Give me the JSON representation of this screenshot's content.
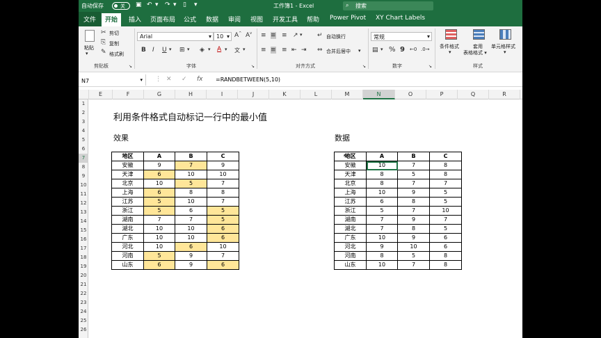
{
  "titlebar": {
    "autosave_label": "自动保存",
    "autosave_state": "关",
    "title": "工作簿1 - Excel",
    "search_placeholder": "搜索"
  },
  "tabs": [
    "文件",
    "开始",
    "插入",
    "页面布局",
    "公式",
    "数据",
    "审阅",
    "视图",
    "开发工具",
    "帮助",
    "Power Pivot",
    "XY Chart Labels"
  ],
  "ribbon": {
    "paste": "粘贴",
    "cut": "剪切",
    "copy": "复制",
    "format_painter": "格式刷",
    "clipboard_group": "剪贴板",
    "font_name": "Arial",
    "font_size": "10",
    "font_group": "字体",
    "wrap_text": "自动换行",
    "merge_center": "合并后居中",
    "alignment_group": "对齐方式",
    "number_format": "常规",
    "number_group": "数字",
    "conditional_format": "条件格式",
    "format_as_table": "套用\n表格格式",
    "cell_styles": "单元格样式",
    "styles_group": "样式",
    "bold": "B",
    "italic": "I",
    "underline": "U",
    "percent": "%",
    "comma": "9"
  },
  "formula_bar": {
    "name_box": "N7",
    "formula": "=RANDBETWEEN(5,10)",
    "fx": "fx"
  },
  "grid": {
    "columns": [
      "E",
      "F",
      "G",
      "H",
      "I",
      "J",
      "K",
      "L",
      "M",
      "N",
      "O",
      "P",
      "Q",
      "R"
    ],
    "selected_column": "N",
    "rows": [
      "1",
      "2",
      "3",
      "4",
      "5",
      "6",
      "7",
      "8",
      "9",
      "10",
      "11",
      "12",
      "13",
      "14",
      "15",
      "16",
      "17",
      "18",
      "19",
      "20",
      "21",
      "22",
      "23",
      "24",
      "25",
      "26"
    ],
    "selected_row": "7"
  },
  "sheet": {
    "title": "利用条件格式自动标记一行中的最小值",
    "left_heading": "效果",
    "right_heading": "数据",
    "headers": [
      "地区",
      "A",
      "B",
      "C"
    ],
    "left_rows": [
      {
        "region": "安徽",
        "a": "9",
        "b": "7",
        "c": "9",
        "min": "b"
      },
      {
        "region": "天津",
        "a": "6",
        "b": "10",
        "c": "10",
        "min": "a"
      },
      {
        "region": "北京",
        "a": "10",
        "b": "5",
        "c": "7",
        "min": "b"
      },
      {
        "region": "上海",
        "a": "6",
        "b": "8",
        "c": "8",
        "min": "a"
      },
      {
        "region": "江苏",
        "a": "5",
        "b": "10",
        "c": "7",
        "min": "a"
      },
      {
        "region": "浙江",
        "a": "5",
        "b": "6",
        "c": "5",
        "min": "ac"
      },
      {
        "region": "湖南",
        "a": "7",
        "b": "7",
        "c": "5",
        "min": "c"
      },
      {
        "region": "湖北",
        "a": "10",
        "b": "10",
        "c": "6",
        "min": "c"
      },
      {
        "region": "广东",
        "a": "10",
        "b": "10",
        "c": "6",
        "min": "c"
      },
      {
        "region": "河北",
        "a": "10",
        "b": "6",
        "c": "10",
        "min": "b"
      },
      {
        "region": "河南",
        "a": "5",
        "b": "9",
        "c": "7",
        "min": "a"
      },
      {
        "region": "山东",
        "a": "6",
        "b": "9",
        "c": "6",
        "min": "ac"
      }
    ],
    "right_rows": [
      {
        "region": "安徽",
        "a": "10",
        "b": "7",
        "c": "8"
      },
      {
        "region": "天津",
        "a": "8",
        "b": "5",
        "c": "8"
      },
      {
        "region": "北京",
        "a": "8",
        "b": "7",
        "c": "7"
      },
      {
        "region": "上海",
        "a": "10",
        "b": "9",
        "c": "5"
      },
      {
        "region": "江苏",
        "a": "6",
        "b": "8",
        "c": "5"
      },
      {
        "region": "浙江",
        "a": "5",
        "b": "7",
        "c": "10"
      },
      {
        "region": "湖南",
        "a": "7",
        "b": "9",
        "c": "7"
      },
      {
        "region": "湖北",
        "a": "7",
        "b": "8",
        "c": "5"
      },
      {
        "region": "广东",
        "a": "10",
        "b": "9",
        "c": "6"
      },
      {
        "region": "河北",
        "a": "9",
        "b": "10",
        "c": "6"
      },
      {
        "region": "河南",
        "a": "8",
        "b": "5",
        "c": "8"
      },
      {
        "region": "山东",
        "a": "10",
        "b": "7",
        "c": "8"
      }
    ]
  },
  "colors": {
    "excel_green": "#1e6e3f",
    "highlight": "#ffe699"
  }
}
